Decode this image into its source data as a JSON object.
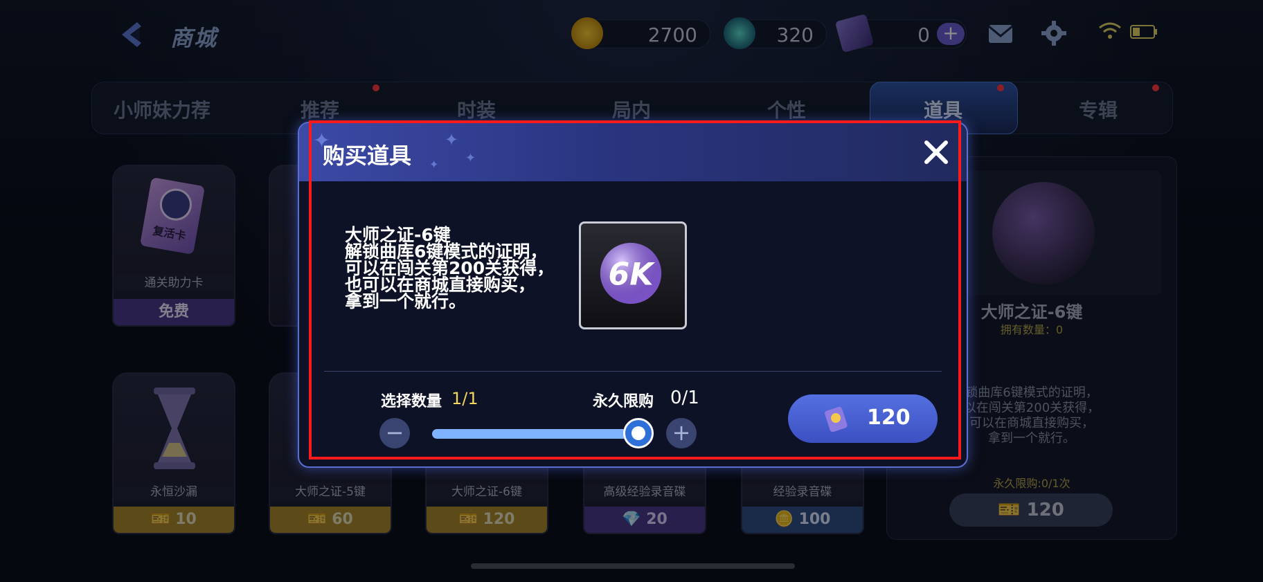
{
  "header": {
    "title": "商城"
  },
  "currencies": [
    {
      "icon": "gold-coin-icon",
      "value": "2700"
    },
    {
      "icon": "gem-icon",
      "value": "320"
    },
    {
      "icon": "ticket-icon",
      "value": "0",
      "plus": "+"
    }
  ],
  "tabs": [
    {
      "label": "小师妹力荐"
    },
    {
      "label": "推荐"
    },
    {
      "label": "时装"
    },
    {
      "label": "局内"
    },
    {
      "label": "个性"
    },
    {
      "label": "道具"
    },
    {
      "label": "专辑"
    }
  ],
  "shop_items": [
    {
      "name": "通关助力卡",
      "price": "免费",
      "art_text": "复活卡"
    },
    {
      "name": "永恒沙漏",
      "price": "10"
    },
    {
      "name": "大师之证-5键",
      "price": "60"
    },
    {
      "name": "大师之证-6键",
      "price": "120"
    },
    {
      "name": "高级经验录音碟",
      "price": "20"
    },
    {
      "name": "经验录音碟",
      "price": "100"
    }
  ],
  "detail": {
    "name": "大师之证-6键",
    "owned": "拥有数量：0",
    "description": "锁曲库6键模式的证明，\n以在闯关第200关获得，\n可以在商城直接购买，\n拿到一个就行。",
    "limit": "永久限购:0/1次",
    "price": "120"
  },
  "modal": {
    "title": "购买道具",
    "item_name": "大师之证-6键",
    "item_desc_lines": [
      "解锁曲库6键模式的证明，",
      "可以在闯关第200关获得，",
      "也可以在商城直接购买，",
      "拿到一个就行。"
    ],
    "qty_label": "选择数量",
    "qty_value": "1/1",
    "limit_label": "永久限购",
    "limit_value": "0/1",
    "minus": "−",
    "plus": "+",
    "slider_fraction": 1.0,
    "buy_price": "120",
    "icon_label": "6K"
  }
}
